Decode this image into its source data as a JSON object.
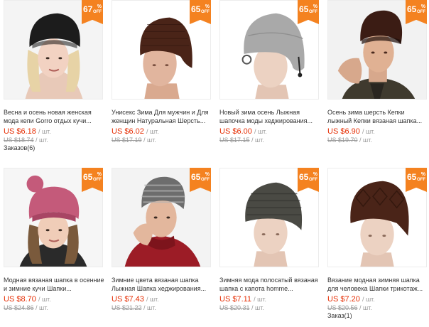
{
  "products": [
    {
      "title": "Весна и осень новая женская мода кепи Gorro отдых кучи...",
      "price": "US $6.18",
      "unit": "/ шт.",
      "old_price": "US $18.74",
      "old_unit": "/ шт.",
      "discount": "67",
      "orders": "Заказов(6)",
      "hat_color": "#1c1c1c",
      "image": "woman-black-beanie"
    },
    {
      "title": "Унисекс Зима Для мужчин и Для женщин Натуральная Шерсть...",
      "price": "US $6.02",
      "unit": "/ шт.",
      "old_price": "US $17.19",
      "old_unit": "/ шт.",
      "discount": "65",
      "orders": "",
      "hat_color": "#4a2418",
      "image": "mannequin-brown-beanie"
    },
    {
      "title": "Новый зима осень Лыжная шапочка моды хеджирования...",
      "price": "US $6.00",
      "unit": "/ шт.",
      "old_price": "US $17.15",
      "old_unit": "/ шт.",
      "discount": "65",
      "orders": "",
      "hat_color": "#a9a9a9",
      "image": "mannequin-gray-beanie"
    },
    {
      "title": "Осень зима шерсть Кепки лыжный Кепки вязаная шапка...",
      "price": "US $6.90",
      "unit": "/ шт.",
      "old_price": "US $19.70",
      "old_unit": "/ шт.",
      "discount": "65",
      "orders": "",
      "hat_color": "#3b1c14",
      "image": "man-brown-beanie"
    },
    {
      "title": "Модная вязаная шапка в осенние и зимние кучи Шапки...",
      "price": "US $8.70",
      "unit": "/ шт.",
      "old_price": "US $24.86",
      "old_unit": "/ шт.",
      "discount": "65",
      "orders": "",
      "hat_color": "#c45a7a",
      "image": "woman-pink-pompom-hat"
    },
    {
      "title": "Зимние цвета вязаная шапка Лыжная Шапка хеджирования...",
      "price": "US $7.43",
      "unit": "/ шт.",
      "old_price": "US $21.22",
      "old_unit": "/ шт.",
      "discount": "65",
      "orders": "",
      "hat_color": "#6d6d6d",
      "image": "man-gray-beanie-red-sweater"
    },
    {
      "title": "Зимняя мода полосатый вязаная шапка с капота homme...",
      "price": "US $7.11",
      "unit": "/ шт.",
      "old_price": "US $20.31",
      "old_unit": "/ шт.",
      "discount": "65",
      "orders": "",
      "hat_color": "#4a4a44",
      "image": "mannequin-olive-beanie"
    },
    {
      "title": "Вязание модная зимняя шапка для человека Шапки трикотаж...",
      "price": "US $7.20",
      "unit": "/ шт.",
      "old_price": "US $20.56",
      "old_unit": "/ шт.",
      "discount": "65",
      "orders": "Заказ(1)",
      "hat_color": "#4a2418",
      "image": "mannequin-brown-knit-beanie"
    }
  ],
  "badge": {
    "percent_sign": "%",
    "off_label": "OFF",
    "color": "#f48220"
  },
  "colors": {
    "price": "#e62e04",
    "muted": "#999999"
  }
}
